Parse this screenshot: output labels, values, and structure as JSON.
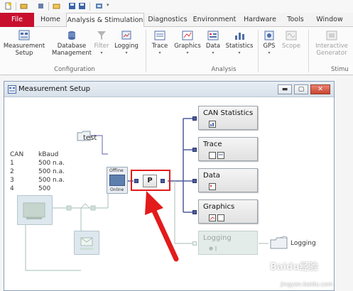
{
  "ribbon": {
    "tabs": [
      {
        "label": "File"
      },
      {
        "label": "Home"
      },
      {
        "label": "Analysis & Stimulation"
      },
      {
        "label": "Diagnostics"
      },
      {
        "label": "Environment"
      },
      {
        "label": "Hardware"
      },
      {
        "label": "Tools"
      },
      {
        "label": "Window"
      }
    ],
    "buttons": {
      "measurement_setup": "Measurement Setup",
      "database_management": "Database Management",
      "filter": "Filter",
      "logging": "Logging",
      "trace": "Trace",
      "graphics": "Graphics",
      "data": "Data",
      "statistics": "Statistics",
      "gps": "GPS",
      "scope": "Scope",
      "interactive_generator": "Interactive Generator",
      "dropdown_glyph": "▾"
    },
    "groups": {
      "configuration": "Configuration",
      "analysis": "Analysis",
      "stimulation": "Stimu"
    }
  },
  "window": {
    "title": "Measurement Setup",
    "min_glyph": "▬",
    "max_glyph": "▢",
    "close_glyph": "✕"
  },
  "setup": {
    "test_label": "test",
    "table_header": {
      "col1": "CAN",
      "col2": "kBaud"
    },
    "channels": [
      {
        "ch": "1",
        "baud": "500 n.a."
      },
      {
        "ch": "2",
        "baud": "500 n.a."
      },
      {
        "ch": "3",
        "baud": "500 n.a."
      },
      {
        "ch": "4",
        "baud": "500"
      }
    ],
    "offline": "Offline",
    "online": "Online",
    "p_block": "P",
    "nodes": {
      "can_statistics": "CAN Statistics",
      "trace": "Trace",
      "data": "Data",
      "graphics": "Graphics",
      "logging": "Logging"
    },
    "logging_file_label": "Logging"
  },
  "watermark": {
    "main": "Baidu经验",
    "sub": "jingyan.baidu.com"
  },
  "colors": {
    "file_tab": "#c8102e",
    "highlight_box": "#e31b1b",
    "arrow": "#e31b1b",
    "connector": "#4d5c9a"
  }
}
